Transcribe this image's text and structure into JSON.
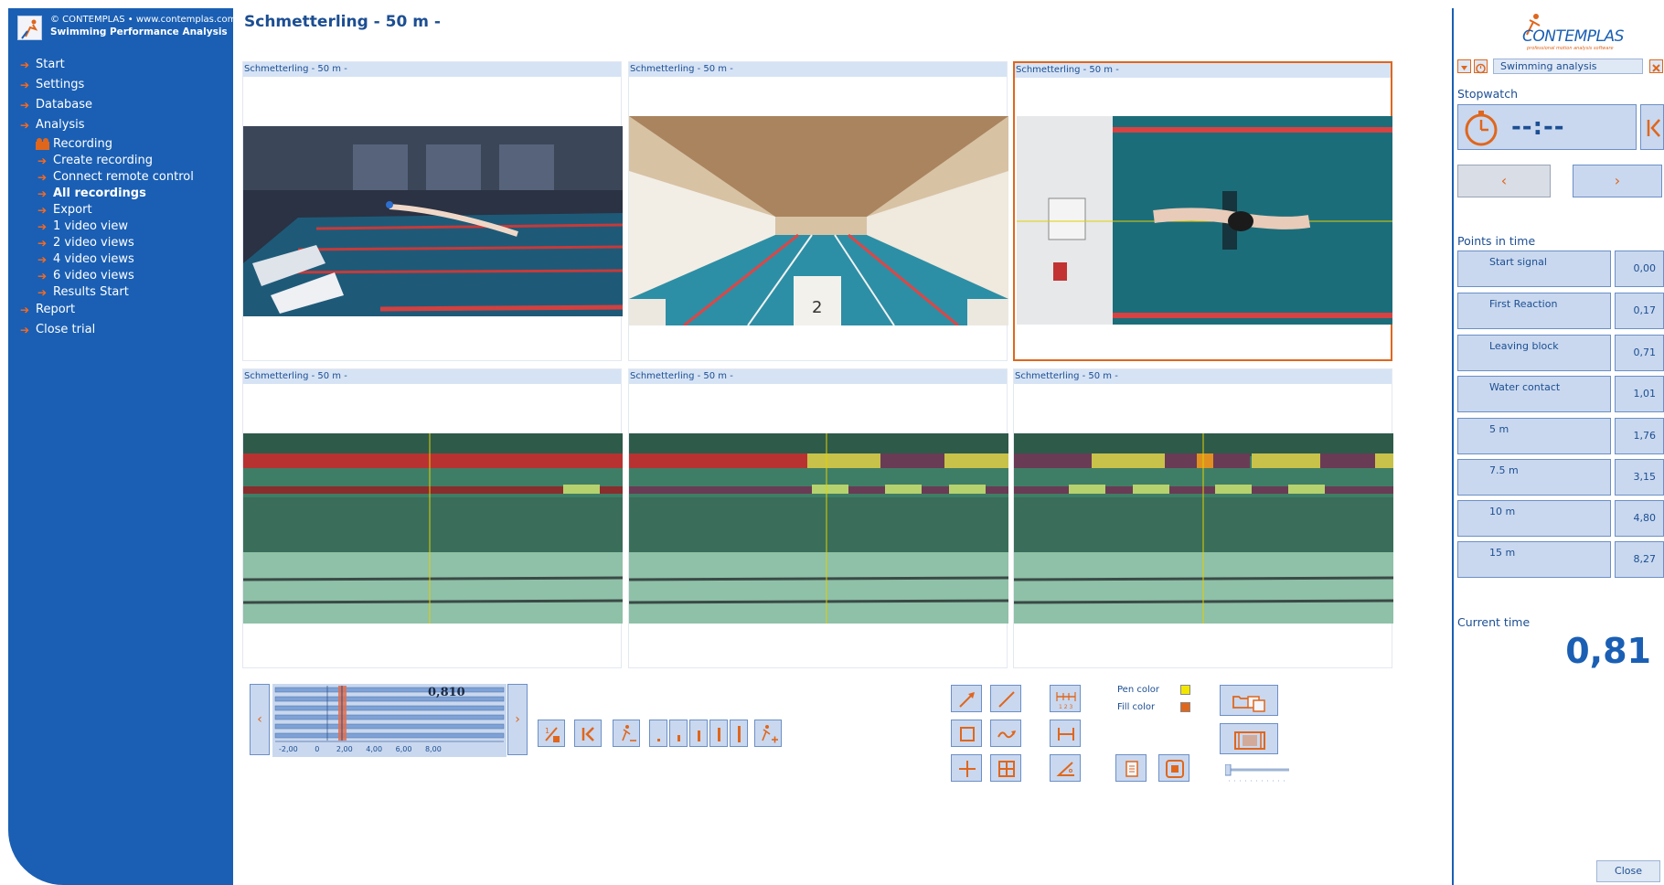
{
  "brand": {
    "copyright": "© CONTEMPLAS • www.contemplas.com",
    "product": "Swimming Performance Analysis"
  },
  "sidebar": {
    "items": [
      {
        "label": "Start"
      },
      {
        "label": "Settings"
      },
      {
        "label": "Database"
      },
      {
        "label": "Analysis"
      }
    ],
    "analysis_sub": [
      {
        "label": "Recording",
        "icon": "recording-icon"
      },
      {
        "label": "Create recording"
      },
      {
        "label": "Connect remote control"
      },
      {
        "label": "All recordings",
        "active": true
      },
      {
        "label": "Export"
      },
      {
        "label": "1 video view"
      },
      {
        "label": "2 video views"
      },
      {
        "label": "4 video views"
      },
      {
        "label": "6 video views"
      },
      {
        "label": "Results Start"
      }
    ],
    "bottom_items": [
      {
        "label": "Report"
      },
      {
        "label": "Close trial"
      }
    ]
  },
  "main": {
    "title": "Schmetterling - 50 m -",
    "videos": [
      {
        "label": "Schmetterling - 50 m -",
        "view": "side-above"
      },
      {
        "label": "Schmetterling - 50 m -",
        "view": "end-on"
      },
      {
        "label": "Schmetterling - 50 m -",
        "view": "overhead",
        "selected": true
      },
      {
        "label": "Schmetterling - 50 m -",
        "view": "underwater"
      },
      {
        "label": "Schmetterling - 50 m -",
        "view": "underwater"
      },
      {
        "label": "Schmetterling - 50 m -",
        "view": "underwater"
      }
    ],
    "timeline": {
      "readout": "0,810",
      "ticks": [
        "-2,00",
        "0",
        "2,00",
        "4,00",
        "6,00",
        "8,00"
      ]
    },
    "drawing": {
      "pen_color_label": "Pen color",
      "fill_color_label": "Fill color",
      "pen_color": "#f2e600",
      "fill_color": "#e0661c"
    }
  },
  "right_panel": {
    "logo_text": "CONTEMPLAS",
    "logo_sub": "professional motion analysis software",
    "tab_label": "Swimming analysis",
    "stopwatch_heading": "Stopwatch",
    "stopwatch_value": "--:--",
    "points_heading": "Points in time",
    "points": [
      {
        "name": "Start signal",
        "value": "0,00"
      },
      {
        "name": "First Reaction",
        "value": "0,17"
      },
      {
        "name": "Leaving block",
        "value": "0,71"
      },
      {
        "name": "Water contact",
        "value": "1,01"
      },
      {
        "name": "5 m",
        "value": "1,76"
      },
      {
        "name": "7.5 m",
        "value": "3,15"
      },
      {
        "name": "10 m",
        "value": "4,80"
      },
      {
        "name": "15 m",
        "value": "8,27"
      }
    ],
    "current_time_heading": "Current time",
    "current_time": "0,81",
    "close_label": "Close"
  },
  "colors": {
    "sidebar_blue": "#1a5fb4",
    "accent_orange": "#e0661c",
    "button_blue": "#c9d8ef"
  }
}
